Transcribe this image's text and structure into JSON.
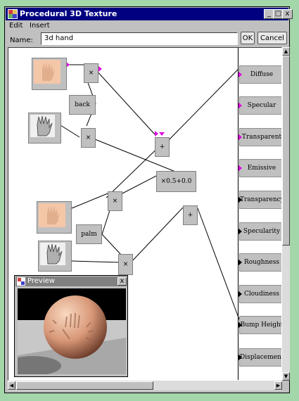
{
  "window": {
    "title": "Procedural 3D Texture",
    "controls": {
      "minimize": "_",
      "maximize": "□",
      "close": "x"
    }
  },
  "menu": {
    "items": [
      "Edit",
      "Insert"
    ]
  },
  "name_bar": {
    "label": "Name:",
    "value": "3d hand",
    "ok": "OK",
    "cancel": "Cancel"
  },
  "graph": {
    "nodes": {
      "multiply_top": "×",
      "back": "back",
      "multiply_mid": "×",
      "add_top": "+",
      "scale": "×0.5+0.0",
      "multiply_lower": "×",
      "palm": "palm",
      "add_lower": "+",
      "multiply_bottom": "×"
    },
    "outputs": [
      "Diffuse",
      "Specular",
      "Transparent",
      "Emissive",
      "Transparency",
      "Specularity",
      "Roughness",
      "Cloudiness",
      "Bump Height",
      "Displacement"
    ]
  },
  "preview": {
    "title": "Preview",
    "close": "x"
  },
  "colors": {
    "titlebar": "#000080",
    "desktop": "#a3d6a9",
    "pin_active": "#e000e0"
  },
  "icons": {
    "app": "texture-icon",
    "hand_image": "hand-icon"
  }
}
